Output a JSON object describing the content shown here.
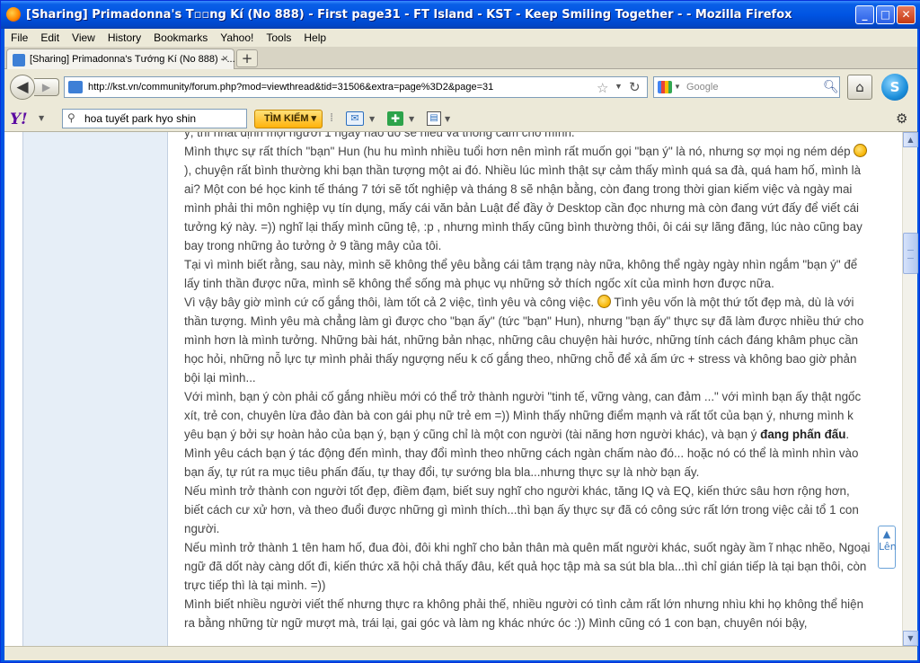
{
  "window": {
    "title": "[Sharing] Primadonna's T▫▫ng Kí (No 888) - First page31 - FT Island - KST - Keep Smiling Together - - Mozilla Firefox",
    "minimize": "_",
    "maximize": "□",
    "close": "✕"
  },
  "menu": [
    "File",
    "Edit",
    "View",
    "History",
    "Bookmarks",
    "Yahoo!",
    "Tools",
    "Help"
  ],
  "tab": {
    "label": "[Sharing] Primadonna's Tướng Kí (No 888) - ...",
    "close": "×",
    "new": "+"
  },
  "nav": {
    "url": "http://kst.vn/community/forum.php?mod=viewthread&tid=31506&extra=page%3D2&page=31",
    "search_placeholder": "Google"
  },
  "yahoo": {
    "logo": "Y!",
    "search_value": "hoa tuyết park hyo shin",
    "search_button": "TÌM KIẾM"
  },
  "post": {
    "line0": "ý, thì nhất định mọi người 1 ngày nào đó sẽ hiểu và thông cảm cho mình.",
    "p1a": "Mình thực sự rất thích \"bạn\" Hun (hu hu mình nhiều tuổi hơn nên mình rất muốn gọi \"bạn ý\" là nó, nhưng sợ mọi ng ném dép ",
    "p1b": "), chuyện rất bình thường khi bạn thần tượng một ai đó. Nhiều lúc mình thật sự cảm thấy mình quá sa đà, quá ham hố, mình là ai? Một con bé học kinh tế tháng 7 tới sẽ tốt nghiệp và tháng 8 sẽ nhận bằng, còn đang trong thời gian kiếm việc và ngày mai mình phải thi môn nghiệp vụ tín dụng, mấy cái văn bản Luật để đầy ở Desktop cần đọc nhưng mà còn đang vứt đấy để viết cái tưởng ký này. =)) nghĩ lại thấy mình cũng tệ, :p , nhưng mình thấy cũng bình thường thôi, ôi cái sự lãng đãng, lúc nào cũng bay bay trong những ảo tưởng ở 9 tầng mây của tôi.",
    "p2": "Tại vì mình biết rằng, sau này, mình sẽ không thể yêu bằng cái tâm trạng này nữa, không thể ngày ngày nhìn ngắm \"bạn ý\" để lấy tinh thần được nữa, mình sẽ không thể sống mà phục vụ những sở thích ngốc xít của mình hơn được nữa.",
    "p3a": "Vì vậy bây giờ mình cứ cố gắng thôi, làm tốt cả 2 việc, tình yêu và công việc. ",
    "p3b": " Tình yêu vốn là một thứ tốt đẹp mà, dù là với thần tượng. Mình yêu mà chẳng làm gì được cho \"bạn ấy\" (tức \"bạn\" Hun), nhưng \"bạn ấy\" thực sự đã làm được nhiều thứ cho mình hơn là mình tưởng. Những bài hát, những bản nhạc, những câu chuyện hài hước, những tính cách đáng khâm phục cần học hỏi, những nỗ lực tự mình phải thấy ngượng nếu k cố gắng theo, những chỗ để xả ấm ức + stress và không bao giờ phản bội lại mình...",
    "p4a": "Với mình, bạn ý còn phải cố gắng nhiều mới có thể trở thành người \"tinh tế, vững vàng, can đảm ...\" với mình bạn ấy thật ngốc xít, trẻ con, chuyên lừa đảo đàn bà con gái phụ nữ trẻ em =)) Mình thấy những điểm mạnh và rất tốt của bạn ý, nhưng mình k yêu bạn ý bởi sự hoàn hảo của bạn ý, bạn ý cũng chỉ là một con người (tài năng hơn người khác), và bạn ý ",
    "p4b": "đang phấn đấu",
    "p4c": ".",
    "p5": "Mình yêu cách bạn ý tác động đến mình, thay đổi  mình theo những cách ngàn chấm nào đó... hoặc nó có thể là mình nhìn vào bạn ấy, tự rút ra mục tiêu phấn đấu, tự thay đổi, tự sướng bla bla...nhưng thực sự là nhờ bạn ấy.",
    "p6": "Nếu mình trở thành con người tốt đẹp, điềm đạm, biết suy nghĩ cho người khác, tăng IQ và EQ, kiến thức sâu hơn rộng hơn, biết cách cư xử hơn, và theo đuổi được những gì mình thích...thì bạn ấy thực sự đã có công sức rất lớn trong việc cải tổ 1 con người.",
    "p7": "Nếu mình trở thành 1 tên ham hố, đua đòi, đôi khi nghĩ cho bản thân mà quên mất người khác, suốt ngày ầm ĩ nhạc nhẽo, Ngoại ngữ đã dốt này càng dốt đi, kiến thức xã hội chả thấy đâu, kết quả học tập mà sa sút bla bla...thì chỉ gián tiếp là tại bạn thôi, còn trực tiếp thì là tại mình. =))",
    "p8": "Mình biết nhiều người viết thế nhưng thực ra không phải thế, nhiều người có tình cảm rất lớn nhưng nhìu khi họ không thể hiện ra bằng những từ ngữ mượt mà, trái lại, gai góc và làm ng khác nhức óc :)) Mình cũng có 1 con bạn, chuyên nói bậy,"
  },
  "float_button": "▲ Lên"
}
